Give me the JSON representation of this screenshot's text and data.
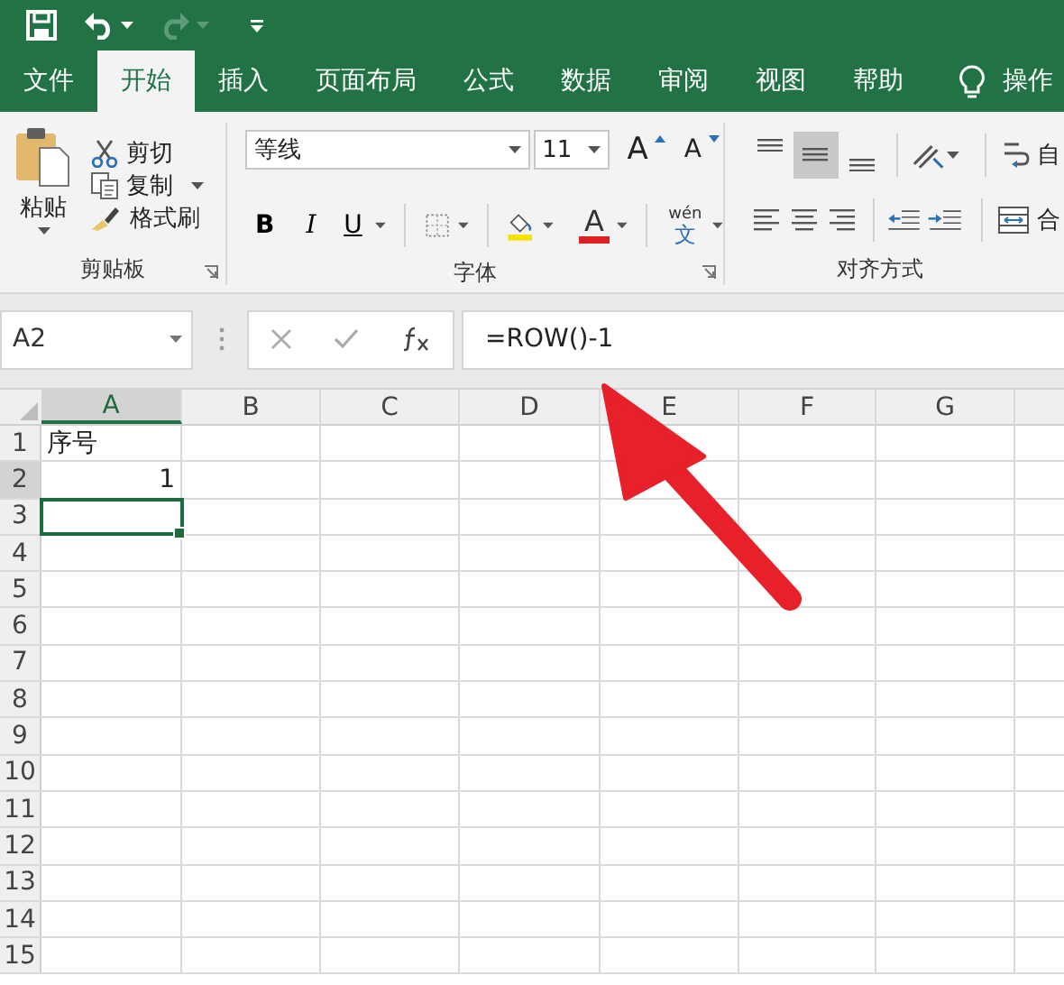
{
  "quick_access": [
    {
      "kind": "save",
      "disabled": false
    },
    {
      "kind": "undo",
      "disabled": false
    },
    {
      "kind": "redo",
      "disabled": true
    },
    {
      "kind": "customize",
      "disabled": false
    }
  ],
  "tabs": [
    {
      "label": "文件",
      "kind": "tab",
      "selected": false
    },
    {
      "label": "开始",
      "kind": "tab",
      "selected": true
    },
    {
      "label": "插入",
      "kind": "tab",
      "selected": false
    },
    {
      "label": "页面布局",
      "kind": "tab",
      "selected": false
    },
    {
      "label": "公式",
      "kind": "tab",
      "selected": false
    },
    {
      "label": "数据",
      "kind": "tab",
      "selected": false
    },
    {
      "label": "审阅",
      "kind": "tab",
      "selected": false
    },
    {
      "label": "视图",
      "kind": "tab",
      "selected": false
    },
    {
      "label": "帮助",
      "kind": "tab",
      "selected": false
    },
    {
      "label": "操作",
      "kind": "tell_me",
      "selected": false
    }
  ],
  "ribbon": {
    "clipboard": {
      "paste": "粘贴",
      "cut": "剪切",
      "copy": "复制",
      "format_painter": "格式刷",
      "label": "剪贴板"
    },
    "font": {
      "name": "等线",
      "size": "11",
      "grow": "A",
      "shrink": "A",
      "bold": "B",
      "italic": "I",
      "underline": "U",
      "font_color": "A",
      "pinyin": "wén",
      "pinyin_char": "文",
      "label": "字体"
    },
    "alignment": {
      "vertical": [
        {
          "kind": "top",
          "selected": false
        },
        {
          "kind": "middle",
          "selected": true
        },
        {
          "kind": "bottom",
          "selected": false
        }
      ],
      "horizontal": [
        {
          "kind": "left",
          "selected": false
        },
        {
          "kind": "center",
          "selected": false
        },
        {
          "kind": "right",
          "selected": false
        }
      ],
      "wrap": "自",
      "merge": "合",
      "label": "对齐方式"
    }
  },
  "formula_bar": {
    "name_box": "A2",
    "formula": "=ROW()-1"
  },
  "sheet": {
    "columns": [
      {
        "label": "A",
        "selected": true
      },
      {
        "label": "B",
        "selected": false
      },
      {
        "label": "C",
        "selected": false
      },
      {
        "label": "D",
        "selected": false
      },
      {
        "label": "E",
        "selected": false
      },
      {
        "label": "F",
        "selected": false
      },
      {
        "label": "G",
        "selected": false
      }
    ],
    "rows": [
      {
        "label": "1",
        "selected": false,
        "cells": [
          {
            "kind": "text",
            "value": "序号",
            "active": false
          }
        ]
      },
      {
        "label": "2",
        "selected": true,
        "cells": [
          {
            "kind": "number",
            "value": "1",
            "active": false
          }
        ]
      },
      {
        "label": "3",
        "selected": false,
        "cells": [
          {
            "kind": "text",
            "active": true
          }
        ]
      },
      {
        "label": "4",
        "selected": false
      },
      {
        "label": "5",
        "selected": false
      },
      {
        "label": "6",
        "selected": false
      },
      {
        "label": "7",
        "selected": false
      },
      {
        "label": "8",
        "selected": false
      },
      {
        "label": "9",
        "selected": false
      },
      {
        "label": "10",
        "selected": false
      },
      {
        "label": "11",
        "selected": false
      },
      {
        "label": "12",
        "selected": false
      },
      {
        "label": "13",
        "selected": false
      },
      {
        "label": "14",
        "selected": false
      },
      {
        "label": "15",
        "selected": false
      }
    ]
  },
  "annotations": [
    {
      "kind": "arrow"
    }
  ]
}
